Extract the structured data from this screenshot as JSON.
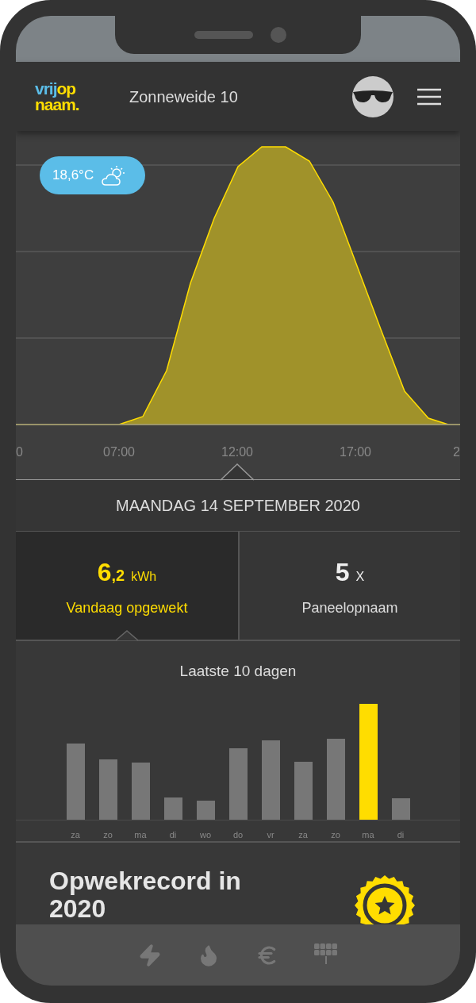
{
  "header": {
    "logo": {
      "line_1": [
        {
          "text": "vrij",
          "color": "#5bbde8"
        },
        {
          "text": "op",
          "color": "#ffdd00"
        }
      ],
      "line_2": [
        {
          "text": "naam.",
          "color": "#ffdd00"
        }
      ]
    },
    "title": "Zonneweide 10"
  },
  "day_chart": {
    "weather": {
      "temperature": "18,6°C"
    },
    "x_ticks": [
      "0",
      "07:00",
      "12:00",
      "17:00",
      "2"
    ]
  },
  "date": "MAANDAG 14 SEPTEMBER 2020",
  "stats": [
    {
      "value_main": "6",
      "value_decimal": ",2",
      "unit": "kWh",
      "label": "Vandaag opgewekt",
      "selected": true
    },
    {
      "value_main": "5",
      "unit": "X",
      "label": "Paneelopnaam",
      "selected": false
    }
  ],
  "history": {
    "title": "Laatste 10 dagen",
    "bars": [
      {
        "day": "za",
        "selected": false
      },
      {
        "day": "zo",
        "selected": false
      },
      {
        "day": "ma",
        "selected": false
      },
      {
        "day": "di",
        "selected": false
      },
      {
        "day": "wo",
        "selected": false
      },
      {
        "day": "do",
        "selected": false
      },
      {
        "day": "vr",
        "selected": false
      },
      {
        "day": "za",
        "selected": false
      },
      {
        "day": "zo",
        "selected": false
      },
      {
        "day": "ma",
        "selected": true
      },
      {
        "day": "di",
        "selected": false
      }
    ]
  },
  "record": {
    "title": "Opwekrecord in 2020"
  }
}
